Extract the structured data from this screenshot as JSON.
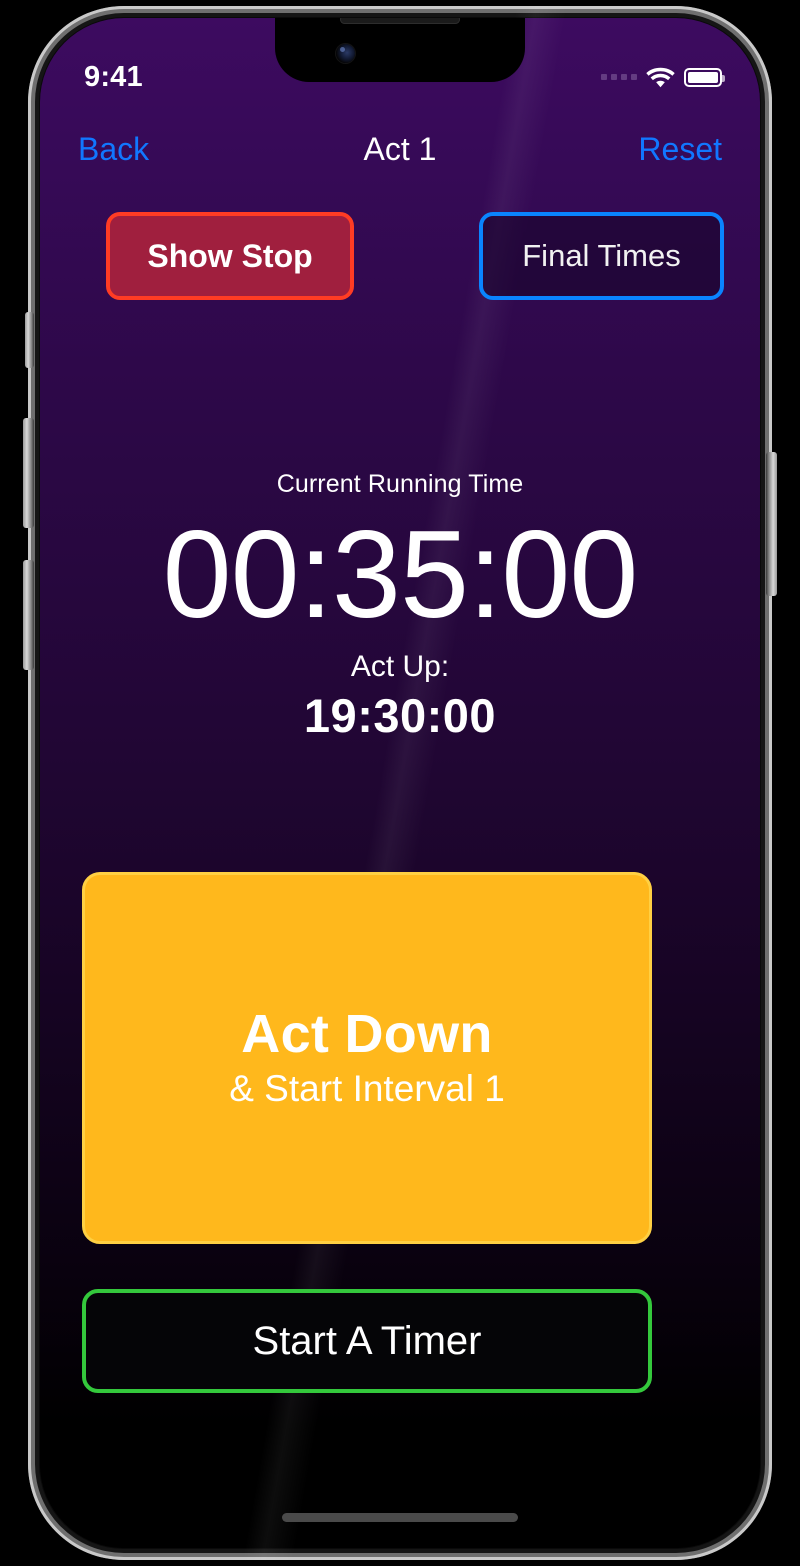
{
  "status_bar": {
    "time": "9:41",
    "signal_icon": "signal-dots-icon",
    "wifi_icon": "wifi-icon",
    "battery_icon": "battery-full-icon"
  },
  "nav": {
    "back_label": "Back",
    "title": "Act 1",
    "reset_label": "Reset"
  },
  "top_actions": {
    "show_stop_label": "Show Stop",
    "final_times_label": "Final Times"
  },
  "timer": {
    "label": "Current Running Time",
    "value": "00:35:00",
    "sub_label": "Act Up:",
    "sub_value": "19:30:00"
  },
  "primary_button": {
    "title": "Act Down",
    "subtitle": "& Start Interval 1"
  },
  "secondary_button": {
    "label": "Start A Timer"
  },
  "colors": {
    "background_top": "#3d0b60",
    "background_bottom": "#000000",
    "accent_orange": "#ffb81c",
    "accent_green": "#34c83c",
    "accent_blue": "#0a84ff",
    "accent_red_border": "#ff3c24",
    "accent_red_fill": "#a01f3e",
    "nav_link": "#1177ff"
  }
}
